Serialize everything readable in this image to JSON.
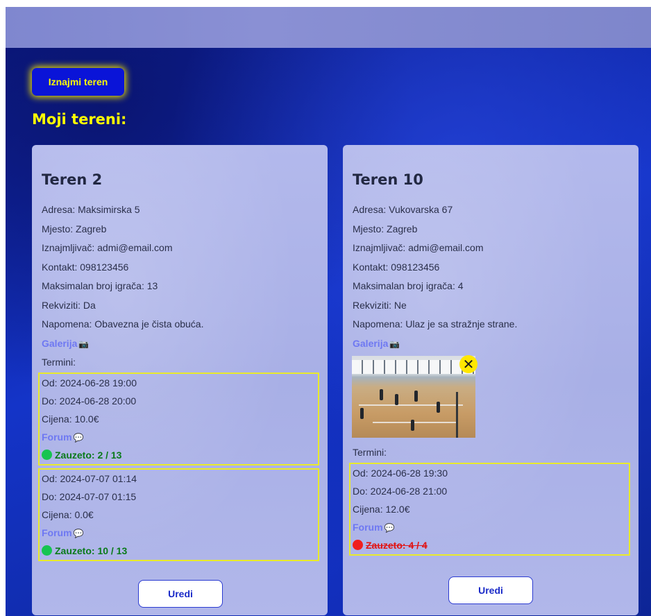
{
  "header": {
    "rent_button": "Iznajmi teren",
    "section_title": "Moji tereni:"
  },
  "fields": [
    {
      "name": "Teren 2",
      "address": "Adresa: Maksimirska 5",
      "city": "Mjesto: Zagreb",
      "landlord": "Iznajmljivač: admi@email.com",
      "contact": "Kontakt: 098123456",
      "max_players": "Maksimalan broj igrača: 13",
      "props": "Rekviziti: Da",
      "note": "Napomena: Obavezna je čista obuća.",
      "gallery_label": "Galerija",
      "gallery_icon": "📷",
      "terms_label": "Termini:",
      "terms": [
        {
          "from": "Od: 2024-06-28 19:00",
          "to": "Do: 2024-06-28 20:00",
          "price": "Cijena: 10.0€",
          "forum_label": "Forum",
          "forum_icon": "💬",
          "status": "Zauzeto: 2 / 13",
          "status_color": "#16c451"
        },
        {
          "from": "Od: 2024-07-07 01:14",
          "to": "Do: 2024-07-07 01:15",
          "price": "Cijena: 0.0€",
          "forum_label": "Forum",
          "forum_icon": "💬",
          "status": "Zauzeto: 10 / 13",
          "status_color": "#16c451"
        }
      ],
      "edit_button": "Uredi"
    },
    {
      "name": "Teren 10",
      "address": "Adresa: Vukovarska 67",
      "city": "Mjesto: Zagreb",
      "landlord": "Iznajmljivač: admi@email.com",
      "contact": "Kontakt: 098123456",
      "max_players": "Maksimalan broj igrača: 4",
      "props": "Rekviziti: Ne",
      "note": "Napomena: Ulaz je sa stražnje strane.",
      "gallery_label": "Galerija",
      "gallery_icon": "📷",
      "photo_close": "✕",
      "terms_label": "Termini:",
      "terms": [
        {
          "from": "Od: 2024-06-28 19:30",
          "to": "Do: 2024-06-28 21:00",
          "price": "Cijena: 12.0€",
          "forum_label": "Forum",
          "forum_icon": "💬",
          "status": "Zauzeto: 4 / 4",
          "status_color": "#f01e1e"
        }
      ],
      "edit_button": "Uredi"
    }
  ],
  "colors": {
    "accent_yellow": "#ffff00",
    "button_blue": "#0a14d8",
    "link": "#6e78f2",
    "available": "#16c451",
    "full": "#f01e1e"
  }
}
